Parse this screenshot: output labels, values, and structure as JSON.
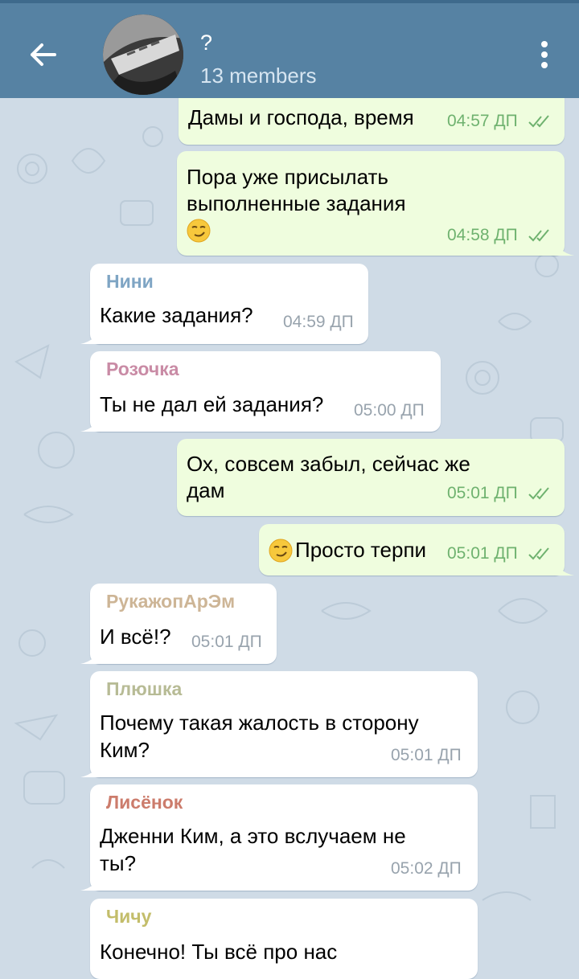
{
  "header": {
    "title": "?",
    "members": "13 members"
  },
  "messages": [
    {
      "id": "m1",
      "dir": "out",
      "text": "Дамы и господа, время",
      "time": "04:57 ДП",
      "status": "read"
    },
    {
      "id": "m2",
      "dir": "out",
      "lines": [
        "Пора уже присылать",
        "выполненные задания"
      ],
      "emoji": "smirk",
      "time": "04:58 ДП",
      "status": "read"
    },
    {
      "id": "m3",
      "dir": "in",
      "sender": "Нини",
      "sender_color": "#7fa5c4",
      "text": "Какие задания?",
      "time": "04:59 ДП"
    },
    {
      "id": "m4",
      "dir": "in",
      "sender": "Розочка",
      "sender_color": "#c98ba5",
      "text": "Ты не дал ей задания?",
      "time": "05:00 ДП"
    },
    {
      "id": "m5",
      "dir": "out",
      "lines": [
        "Ох, совсем забыл, сейчас же",
        "дам"
      ],
      "time": "05:01 ДП",
      "status": "read"
    },
    {
      "id": "m6",
      "dir": "out",
      "emoji": "smirk",
      "text": "Просто терпи",
      "time": "05:01 ДП",
      "status": "read"
    },
    {
      "id": "m7",
      "dir": "in",
      "sender": "РукажопАрЭм",
      "sender_color": "#cdb596",
      "text": "И всё!?",
      "time": "05:01 ДП"
    },
    {
      "id": "m8",
      "dir": "in",
      "sender": "Плюшка",
      "sender_color": "#b7bb95",
      "lines": [
        "Почему такая жалость в сторону",
        "Ким?"
      ],
      "time": "05:01 ДП"
    },
    {
      "id": "m9",
      "dir": "in",
      "sender": "Лисёнок",
      "sender_color": "#cc7c6c",
      "lines": [
        "Дженни Ким, а это вслучаем не",
        "ты?"
      ],
      "time": "05:02 ДП"
    },
    {
      "id": "m10",
      "dir": "in",
      "sender": "Чичу",
      "sender_color": "#c3bd6a",
      "text": "Конечно! Ты всё про нас"
    }
  ],
  "colors": {
    "header": "#5682a3",
    "outgoing_bubble": "#effdde",
    "incoming_bubble": "#ffffff",
    "read_ticks": "#6fb26f"
  },
  "icons": [
    "back-arrow-icon",
    "overflow-menu-icon",
    "smirk-emoji-icon",
    "double-check-icon"
  ]
}
